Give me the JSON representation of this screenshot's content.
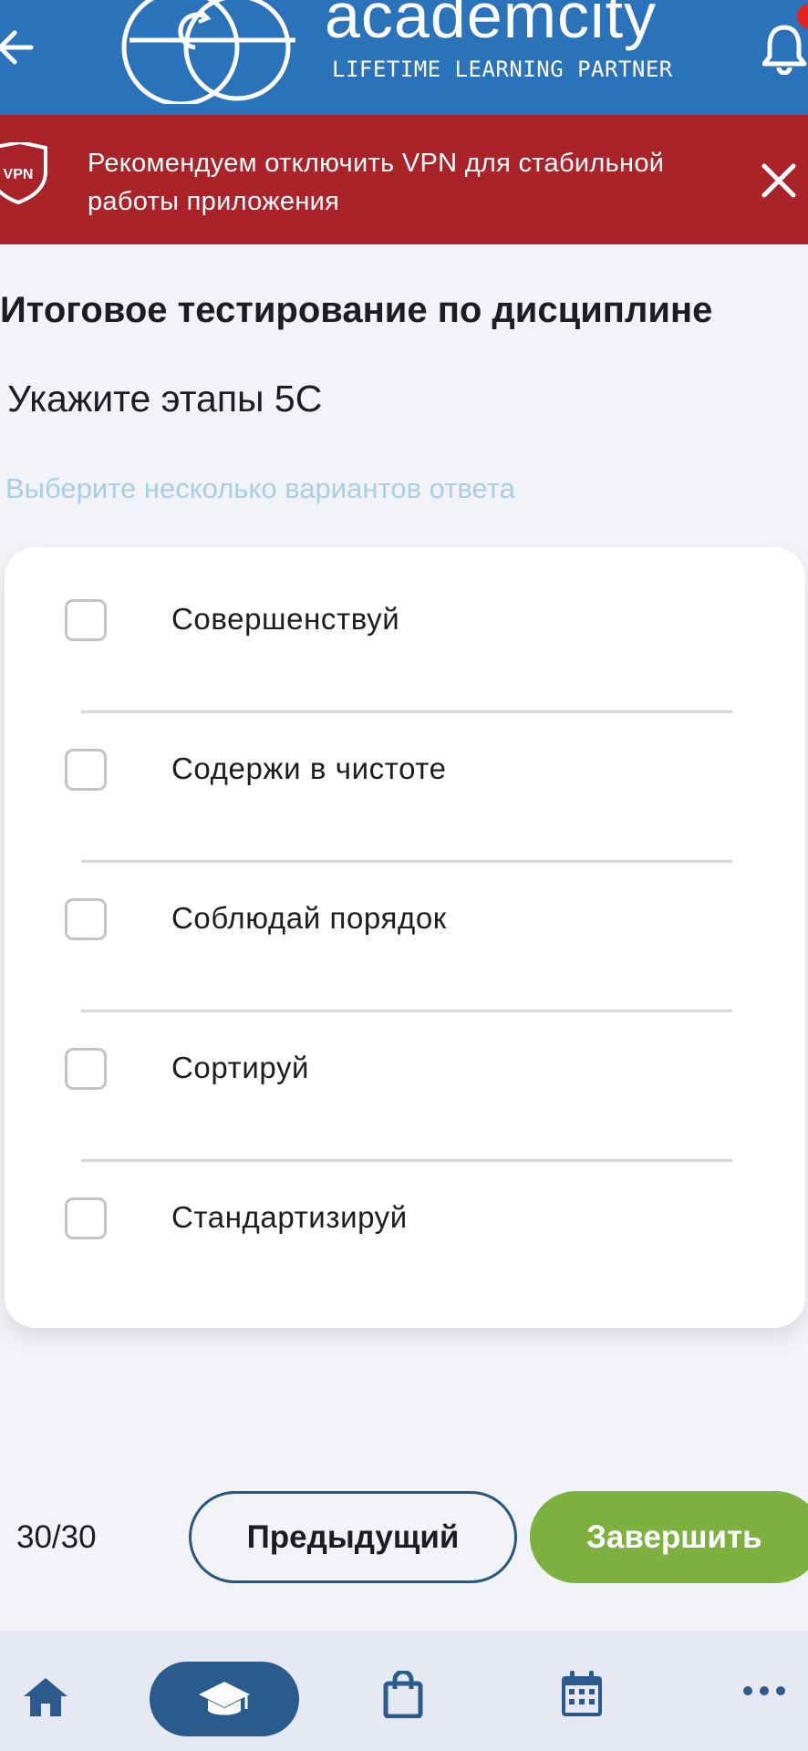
{
  "header": {
    "logo_word": "academcity",
    "logo_tagline": "LIFETIME LEARNING PARTNER",
    "brand_color": "#2a72b9"
  },
  "banner": {
    "text": "Рекомендуем отключить VPN для стабильной работы приложения",
    "shield_label": "VPN",
    "color": "#a92328"
  },
  "test": {
    "title": "Итоговое тестирование по дисциплине",
    "question": "Укажите этапы 5С",
    "hint": "Выберите несколько вариантов ответа",
    "options": [
      {
        "label": "Совершенствуй",
        "checked": false
      },
      {
        "label": "Содержи в чистоте",
        "checked": false
      },
      {
        "label": "Соблюдай порядок",
        "checked": false
      },
      {
        "label": "Сортируй",
        "checked": false
      },
      {
        "label": "Стандартизируй",
        "checked": false
      }
    ]
  },
  "footer": {
    "counter": "30/30",
    "prev_label": "Предыдущий",
    "finish_label": "Завершить",
    "finish_color": "#7cb13f"
  },
  "nav": {
    "items": [
      {
        "icon": "home-icon",
        "active": false
      },
      {
        "icon": "graduation-cap-icon",
        "active": true
      },
      {
        "icon": "shopping-bag-icon",
        "active": false
      },
      {
        "icon": "calendar-icon",
        "active": false
      },
      {
        "icon": "more-icon",
        "active": false
      }
    ],
    "icon_color": "#2b5b8c"
  }
}
